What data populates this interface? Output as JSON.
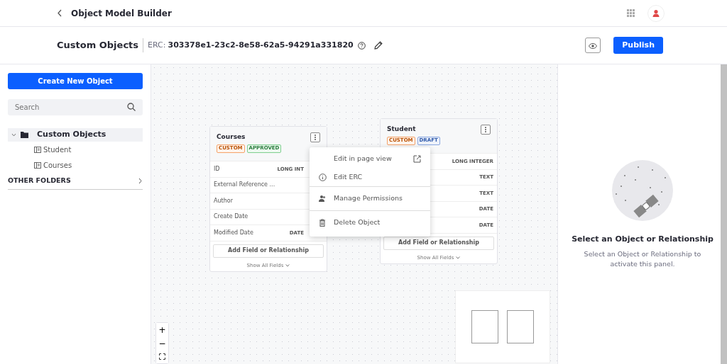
{
  "topbar": {
    "title": "Object Model Builder"
  },
  "header": {
    "title": "Custom Objects",
    "erc_label": "ERC:",
    "erc_value": "303378e1-23c2-8e58-62a5-94291a331820",
    "publish": "Publish"
  },
  "sidebar": {
    "create_button": "Create New Object",
    "search": {
      "placeholder": "Search"
    },
    "tree": [
      {
        "label": "Custom Objects",
        "expanded": true,
        "selected": true,
        "children": [
          {
            "label": "Student"
          },
          {
            "label": "Courses"
          }
        ]
      }
    ],
    "other_folders": "OTHER FOLDERS"
  },
  "objects": [
    {
      "title": "Courses",
      "badges": [
        {
          "label": "CUSTOM",
          "kind": "custom"
        },
        {
          "label": "APPROVED",
          "kind": "approved"
        }
      ],
      "fields": [
        {
          "name": "ID",
          "type": "LONG INT"
        },
        {
          "name": "External Reference ..."
        },
        {
          "name": "Author"
        },
        {
          "name": "Create Date"
        },
        {
          "name": "Modified Date",
          "type": "DATE"
        }
      ],
      "add_button": "Add Field or Relationship",
      "show_all": "Show All Fields"
    },
    {
      "title": "Student",
      "badges": [
        {
          "label": "CUSTOM",
          "kind": "custom"
        },
        {
          "label": "DRAFT",
          "kind": "draft"
        }
      ],
      "fields": [
        {
          "type": "LONG INTEGER"
        },
        {
          "type": "TEXT"
        },
        {
          "type": "TEXT"
        },
        {
          "type": "DATE"
        },
        {
          "type": "DATE"
        }
      ],
      "add_button": "Add Field or Relationship",
      "show_all": "Show All Fields"
    }
  ],
  "context_menu": [
    {
      "label": "Edit in page view",
      "kind": "external"
    },
    {
      "label": "Edit ERC",
      "kind": "info"
    },
    {
      "label": "Manage Permissions",
      "kind": "users"
    },
    {
      "label": "Delete Object",
      "kind": "trash"
    }
  ],
  "zoom_controls": [
    "+",
    "−"
  ],
  "panel": {
    "title": "Select an Object or Relationship",
    "text": "Select an Object or Relationship to activate this panel."
  }
}
